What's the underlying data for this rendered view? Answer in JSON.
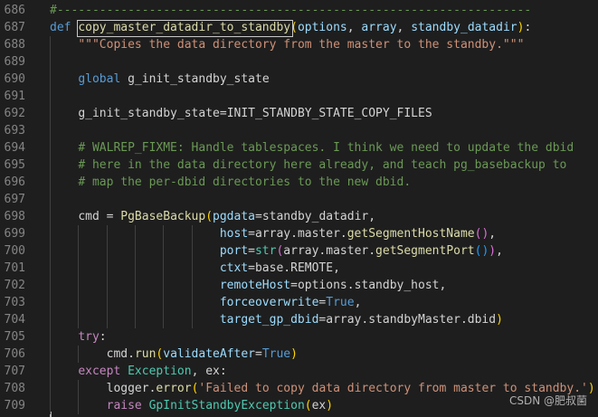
{
  "lines": [
    {
      "n": "686",
      "segs": [
        [
          "cmt",
          "#-------------------------------------------------------------------"
        ]
      ]
    },
    {
      "n": "687",
      "segs": [
        [
          "kw",
          "def "
        ],
        [
          "fn",
          "copy_master_datadir_to_standby"
        ],
        [
          "paren-y",
          "("
        ],
        [
          "param",
          "options"
        ],
        [
          "plain",
          ", "
        ],
        [
          "param",
          "array"
        ],
        [
          "plain",
          ", "
        ],
        [
          "param",
          "standby_datadir"
        ],
        [
          "paren-y",
          ")"
        ],
        [
          "plain",
          ":"
        ]
      ]
    },
    {
      "n": "688",
      "segs": [
        [
          "plain",
          "    "
        ],
        [
          "str",
          "\"\"\"Copies the data directory from the master to the standby.\"\"\""
        ]
      ]
    },
    {
      "n": "689",
      "segs": []
    },
    {
      "n": "690",
      "segs": [
        [
          "plain",
          "    "
        ],
        [
          "kw",
          "global "
        ],
        [
          "plain",
          "g_init_standby_state"
        ]
      ]
    },
    {
      "n": "691",
      "segs": []
    },
    {
      "n": "692",
      "segs": [
        [
          "plain",
          "    "
        ],
        [
          "plain",
          "g_init_standby_state"
        ],
        [
          "plain",
          "="
        ],
        [
          "plain",
          "INIT_STANDBY_STATE_COPY_FILES"
        ]
      ]
    },
    {
      "n": "693",
      "segs": []
    },
    {
      "n": "694",
      "segs": [
        [
          "plain",
          "    "
        ],
        [
          "cmt",
          "# WALREP_FIXME: Handle tablespaces. I think we need to update the dbid"
        ]
      ]
    },
    {
      "n": "695",
      "segs": [
        [
          "plain",
          "    "
        ],
        [
          "cmt",
          "# here in the data directory here already, and teach pg_basebackup to"
        ]
      ]
    },
    {
      "n": "696",
      "segs": [
        [
          "plain",
          "    "
        ],
        [
          "cmt",
          "# map the per-dbid directories to the new dbid."
        ]
      ]
    },
    {
      "n": "697",
      "segs": []
    },
    {
      "n": "698",
      "segs": [
        [
          "plain",
          "    "
        ],
        [
          "plain",
          "cmd = "
        ],
        [
          "fn",
          "PgBaseBackup"
        ],
        [
          "paren-y",
          "("
        ],
        [
          "param",
          "pgdata"
        ],
        [
          "plain",
          "=standby_datadir,"
        ]
      ]
    },
    {
      "n": "699",
      "segs": [
        [
          "plain",
          "                        "
        ],
        [
          "param",
          "host"
        ],
        [
          "plain",
          "=array.master."
        ],
        [
          "fn",
          "getSegmentHostName"
        ],
        [
          "paren-p",
          "()"
        ],
        [
          "plain",
          ","
        ]
      ]
    },
    {
      "n": "700",
      "segs": [
        [
          "plain",
          "                        "
        ],
        [
          "param",
          "port"
        ],
        [
          "plain",
          "="
        ],
        [
          "cls",
          "str"
        ],
        [
          "paren-p",
          "("
        ],
        [
          "plain",
          "array.master."
        ],
        [
          "fn",
          "getSegmentPort"
        ],
        [
          "paren-b",
          "()"
        ],
        [
          "paren-p",
          ")"
        ],
        [
          "plain",
          ","
        ]
      ]
    },
    {
      "n": "701",
      "segs": [
        [
          "plain",
          "                        "
        ],
        [
          "param",
          "ctxt"
        ],
        [
          "plain",
          "=base.REMOTE,"
        ]
      ]
    },
    {
      "n": "702",
      "segs": [
        [
          "plain",
          "                        "
        ],
        [
          "param",
          "remoteHost"
        ],
        [
          "plain",
          "=options.standby_host,"
        ]
      ]
    },
    {
      "n": "703",
      "segs": [
        [
          "plain",
          "                        "
        ],
        [
          "param",
          "forceoverwrite"
        ],
        [
          "plain",
          "="
        ],
        [
          "kw",
          "True"
        ],
        [
          "plain",
          ","
        ]
      ]
    },
    {
      "n": "704",
      "segs": [
        [
          "plain",
          "                        "
        ],
        [
          "param",
          "target_gp_dbid"
        ],
        [
          "plain",
          "=array.standbyMaster.dbid"
        ],
        [
          "paren-y",
          ")"
        ]
      ]
    },
    {
      "n": "705",
      "segs": [
        [
          "plain",
          "    "
        ],
        [
          "kw2",
          "try"
        ],
        [
          "plain",
          ":"
        ]
      ]
    },
    {
      "n": "706",
      "segs": [
        [
          "plain",
          "        "
        ],
        [
          "plain",
          "cmd."
        ],
        [
          "fn",
          "run"
        ],
        [
          "paren-y",
          "("
        ],
        [
          "param",
          "validateAfter"
        ],
        [
          "plain",
          "="
        ],
        [
          "kw",
          "True"
        ],
        [
          "paren-y",
          ")"
        ]
      ]
    },
    {
      "n": "707",
      "segs": [
        [
          "plain",
          "    "
        ],
        [
          "kw2",
          "except "
        ],
        [
          "cls",
          "Exception"
        ],
        [
          "plain",
          ", ex:"
        ]
      ]
    },
    {
      "n": "708",
      "segs": [
        [
          "plain",
          "        "
        ],
        [
          "plain",
          "logger."
        ],
        [
          "fn",
          "error"
        ],
        [
          "paren-y",
          "("
        ],
        [
          "str",
          "'Failed to copy data directory from master to standby.'"
        ],
        [
          "paren-y",
          ")"
        ]
      ]
    },
    {
      "n": "709",
      "segs": [
        [
          "plain",
          "        "
        ],
        [
          "kw2",
          "raise "
        ],
        [
          "cls",
          "GpInitStandbyException"
        ],
        [
          "paren-y",
          "("
        ],
        [
          "plain",
          "ex"
        ],
        [
          "paren-y",
          ")"
        ]
      ]
    }
  ],
  "watermark": "CSDN @肥叔菌"
}
